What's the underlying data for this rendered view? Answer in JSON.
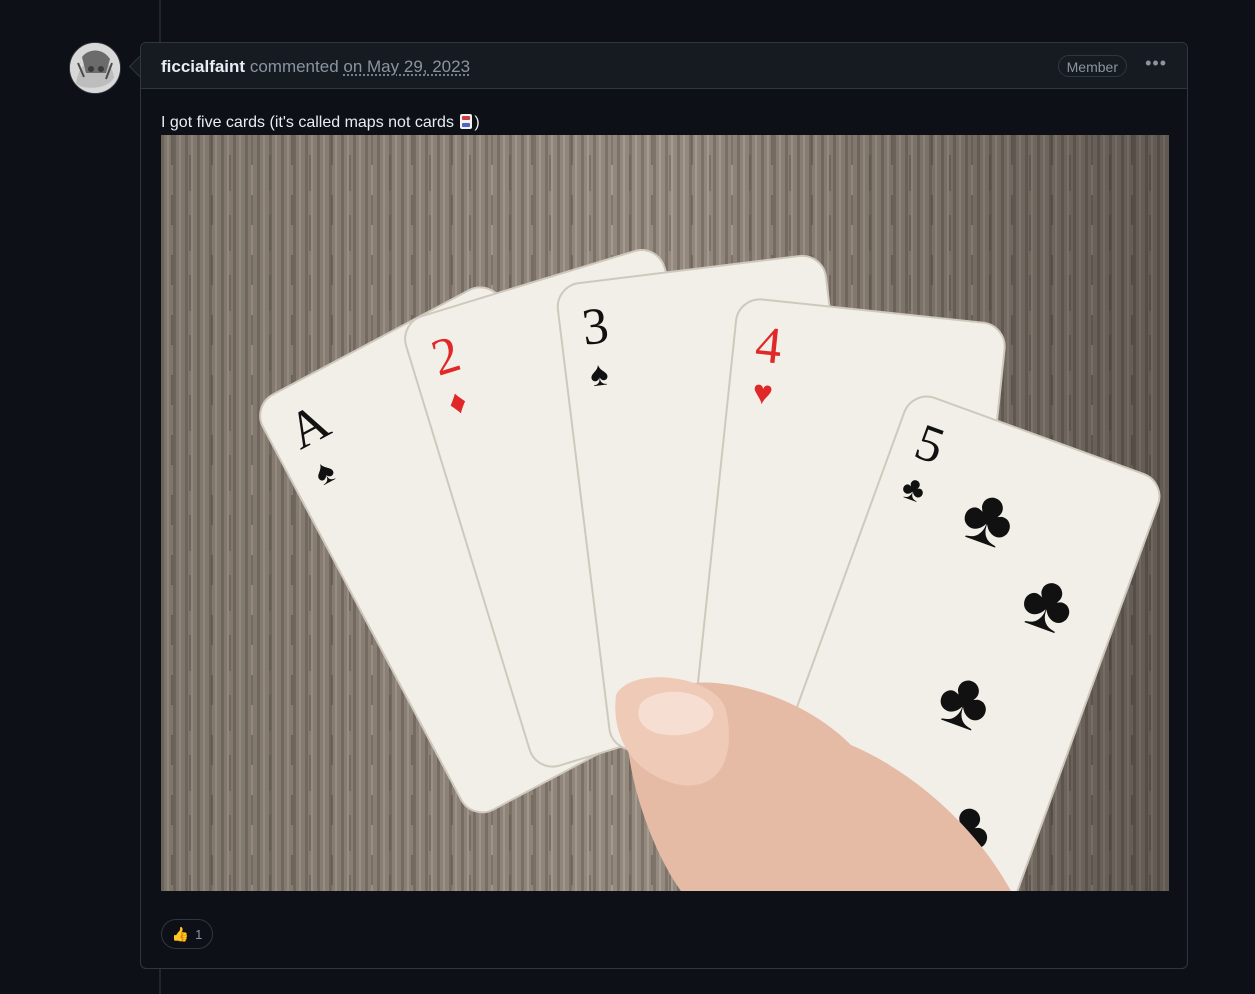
{
  "comment": {
    "author": "ficcialfaint",
    "action": "commented",
    "date_link": "on May 29, 2023",
    "role_badge": "Member",
    "menu_icon": "kebab-horizontal-icon",
    "body_before": "I got five cards (it's called maps not cards ",
    "body_emoji_icon": "joker-card-emoji",
    "body_after": ")",
    "photo_cards": [
      {
        "rank": "A",
        "suit": "spades",
        "color": "#111111"
      },
      {
        "rank": "2",
        "suit": "diamonds",
        "color": "#e02828"
      },
      {
        "rank": "3",
        "suit": "spades",
        "color": "#111111"
      },
      {
        "rank": "4",
        "suit": "hearts",
        "color": "#e02828"
      },
      {
        "rank": "5",
        "suit": "clubs",
        "color": "#111111"
      }
    ],
    "reaction": {
      "icon": "thumbs-up-icon",
      "emoji": "👍",
      "count": "1"
    }
  }
}
